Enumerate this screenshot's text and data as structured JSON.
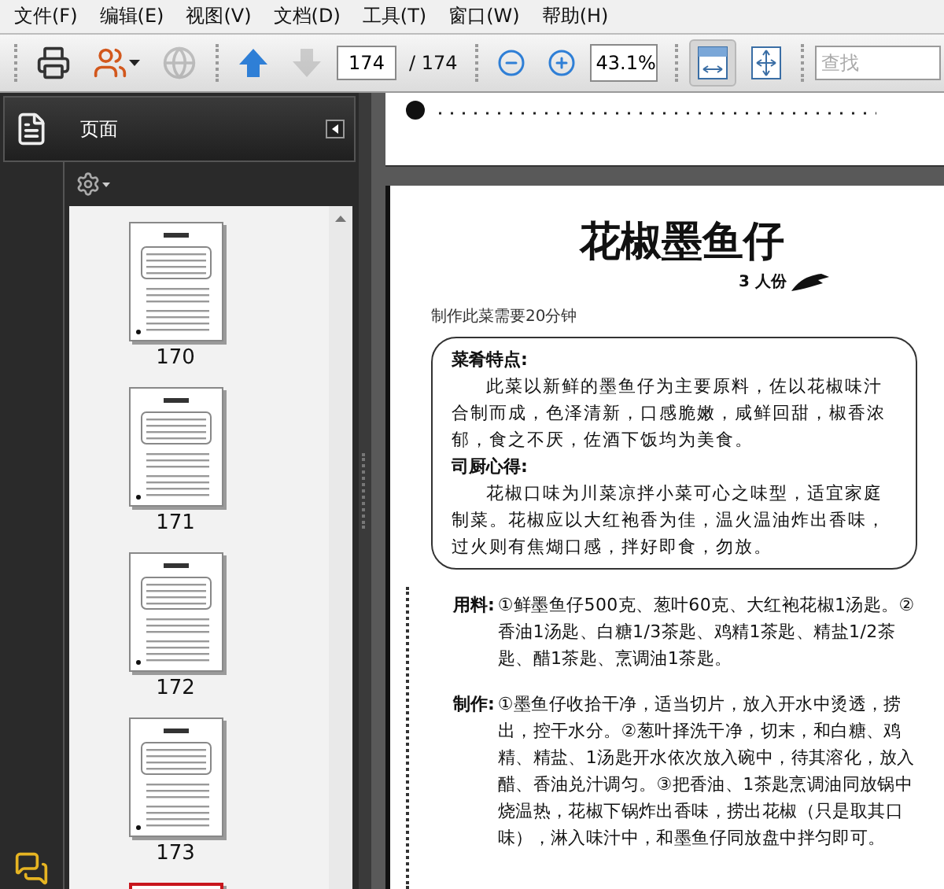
{
  "menu": [
    {
      "label": "文件(F)"
    },
    {
      "label": "编辑(E)"
    },
    {
      "label": "视图(V)"
    },
    {
      "label": "文档(D)"
    },
    {
      "label": "工具(T)"
    },
    {
      "label": "窗口(W)"
    },
    {
      "label": "帮助(H)"
    }
  ],
  "toolbar": {
    "tools": [
      {
        "kind": "print",
        "disabled": false
      },
      {
        "kind": "share",
        "disabled": false
      },
      {
        "kind": "web",
        "disabled": true
      }
    ],
    "nav": [
      {
        "kind": "previous",
        "disabled": false
      },
      {
        "kind": "next",
        "disabled": true
      }
    ],
    "page_number": "174",
    "page_count": "/ 174",
    "zoom": "43.1%",
    "fit_buttons": [
      {
        "kind": "fit-width",
        "selected": true
      },
      {
        "kind": "fit-page",
        "selected": false
      }
    ],
    "search": {
      "placeholder": "查找"
    }
  },
  "panel": {
    "title": "页面",
    "thumbnails": [
      {
        "label": "170",
        "selected": false
      },
      {
        "label": "171",
        "selected": false
      },
      {
        "label": "172",
        "selected": false
      },
      {
        "label": "173",
        "selected": false
      },
      {
        "selected": true
      }
    ]
  },
  "document": {
    "title": "花椒墨鱼仔",
    "servings": "3 人份",
    "time_note": "制作此菜需要20分钟",
    "box_sections": [
      {
        "heading": "菜肴特点:",
        "text": "此菜以新鲜的墨鱼仔为主要原料，佐以花椒味汁合制而成，色泽清新，口感脆嫩，咸鲜回甜，椒香浓郁，食之不厌，佐酒下饭均为美食。"
      },
      {
        "heading": "司厨心得:",
        "text": "花椒口味为川菜凉拌小菜可心之味型，适宜家庭制菜。花椒应以大红袍香为佳，温火温油炸出香味，过火则有焦煳口感，拌好即食，勿放。"
      }
    ],
    "recipe": [
      {
        "label": "用料:",
        "text": "①鲜墨鱼仔500克、葱叶60克、大红袍花椒1汤匙。②香油1汤匙、白糖1/3茶匙、鸡精1茶匙、精盐1/2茶匙、醋1茶匙、烹调油1茶匙。"
      },
      {
        "label": "制作:",
        "text": "①墨鱼仔收拾干净，适当切片，放入开水中烫透，捞出，控干水分。②葱叶择洗干净，切末，和白糖、鸡精、精盐、1汤匙开水依次放入碗中，待其溶化，放入醋、香油兑汁调匀。③把香油、1茶匙烹调油同放锅中烧温热，花椒下锅炸出香味，捞出花椒（只是取其口味），淋入味汁中，和墨鱼仔同放盘中拌匀即可。"
      }
    ]
  }
}
